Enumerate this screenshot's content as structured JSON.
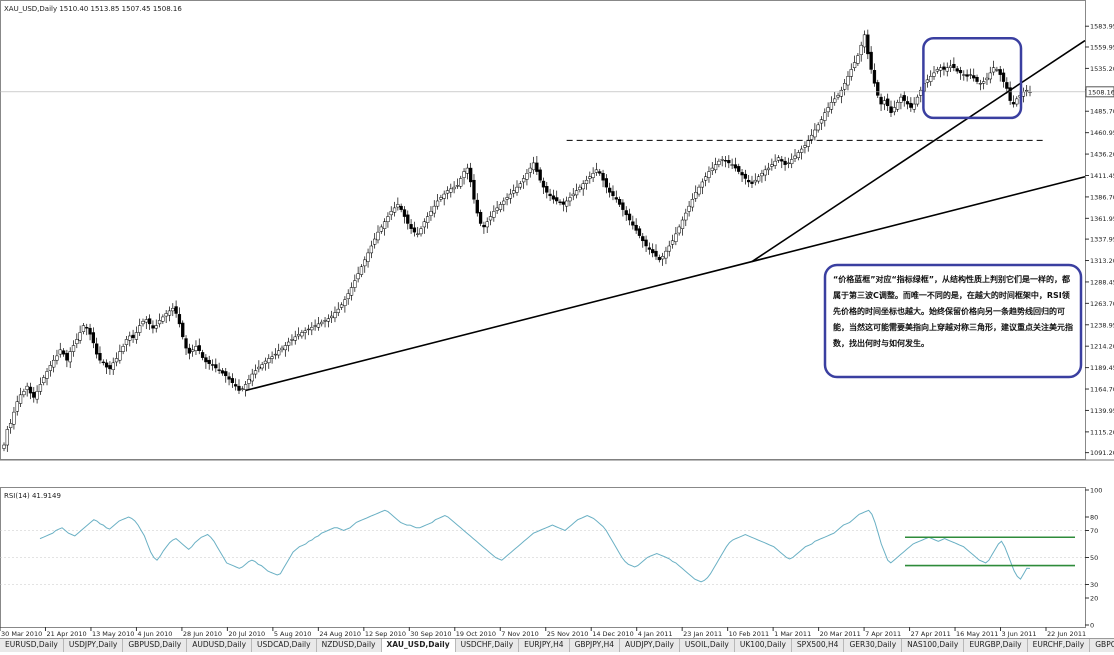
{
  "price_header": "XAU_USD,Daily  1510.40 1513.85 1507.45 1508.16",
  "rsi_header": "RSI(14) 41.9149",
  "current_price_label": "1508.16",
  "annotation_text": "“价格蓝框”对应“指标绿框”，从结构性质上判别它们是一样的，都属于第三波C调整。而唯一不同的是，在越大的时间框架中，RSI领先价格的时间坐标也越大。始终保留价格向另一条趋势线回归的可能，当然这可能需要美指向上穿越对称三角形，建议重点关注美元指数，找出何时与如何发生。",
  "colors": {
    "up_candle": "#ffffff",
    "down_candle": "#000000",
    "rsi_line": "#6ab0c4",
    "blue_box": "#3a3fa0",
    "green_box": "#2e8b3a",
    "grid": "#c8c8c8"
  },
  "chart_data": [
    {
      "type": "candlestick",
      "symbol": "XAU_USD",
      "timeframe": "Daily",
      "ohlc_last": {
        "open": 1510.4,
        "high": 1513.85,
        "low": 1507.45,
        "close": 1508.16
      },
      "y_ticks": [
        "1583.95",
        "1559.95",
        "1535.20",
        "1510.45",
        "1485.70",
        "1460.95",
        "1436.20",
        "1411.45",
        "1386.70",
        "1361.95",
        "1337.95",
        "1313.20",
        "1288.45",
        "1263.70",
        "1238.95",
        "1214.20",
        "1189.45",
        "1164.70",
        "1139.95",
        "1115.20",
        "1091.20"
      ],
      "x_ticks": [
        "30 Mar 2010",
        "21 Apr 2010",
        "13 May 2010",
        "4 Jun 2010",
        "28 Jun 2010",
        "20 Jul 2010",
        "5 Aug 2010",
        "24 Aug 2010",
        "12 Sep 2010",
        "30 Sep 2010",
        "19 Oct 2010",
        "7 Nov 2010",
        "25 Nov 2010",
        "14 Dec 2010",
        "4 Jan 2011",
        "23 Jan 2011",
        "10 Feb 2011",
        "1 Mar 2011",
        "20 Mar 2011",
        "7 Apr 2011",
        "27 Apr 2011",
        "16 May 2011",
        "3 Jun 2011",
        "22 Jun 2011"
      ],
      "ylim": [
        1085,
        1605
      ],
      "closes": [
        1100,
        1118,
        1125,
        1138,
        1150,
        1158,
        1162,
        1168,
        1160,
        1155,
        1162,
        1170,
        1178,
        1185,
        1192,
        1198,
        1203,
        1210,
        1205,
        1198,
        1208,
        1215,
        1222,
        1230,
        1238,
        1235,
        1228,
        1218,
        1205,
        1198,
        1195,
        1190,
        1188,
        1195,
        1200,
        1208,
        1214,
        1222,
        1226,
        1224,
        1230,
        1238,
        1243,
        1245,
        1240,
        1235,
        1238,
        1244,
        1248,
        1252,
        1255,
        1258,
        1252,
        1240,
        1225,
        1212,
        1206,
        1210,
        1214,
        1209,
        1201,
        1196,
        1194,
        1192,
        1189,
        1186,
        1183,
        1180,
        1176,
        1172,
        1168,
        1163,
        1165,
        1170,
        1176,
        1182,
        1186,
        1190,
        1193,
        1197,
        1200,
        1202,
        1205,
        1209,
        1212,
        1215,
        1219,
        1222,
        1225,
        1228,
        1230,
        1232,
        1234,
        1236,
        1238,
        1240,
        1242,
        1244,
        1246,
        1249,
        1253,
        1257,
        1262,
        1268,
        1275,
        1282,
        1290,
        1298,
        1306,
        1314,
        1322,
        1330,
        1338,
        1346,
        1352,
        1358,
        1364,
        1370,
        1374,
        1378,
        1372,
        1364,
        1356,
        1350,
        1346,
        1344,
        1350,
        1358,
        1364,
        1370,
        1376,
        1382,
        1386,
        1390,
        1394,
        1396,
        1398,
        1400,
        1408,
        1416,
        1420,
        1404,
        1384,
        1368,
        1356,
        1352,
        1358,
        1364,
        1370,
        1374,
        1378,
        1382,
        1386,
        1390,
        1394,
        1398,
        1402,
        1408,
        1414,
        1420,
        1426,
        1416,
        1406,
        1398,
        1392,
        1388,
        1384,
        1382,
        1380,
        1378,
        1382,
        1386,
        1390,
        1394,
        1398,
        1402,
        1406,
        1410,
        1414,
        1418,
        1414,
        1406,
        1398,
        1392,
        1388,
        1384,
        1378,
        1372,
        1366,
        1360,
        1354,
        1348,
        1342,
        1336,
        1330,
        1326,
        1322,
        1318,
        1314,
        1318,
        1324,
        1330,
        1336,
        1344,
        1352,
        1360,
        1368,
        1376,
        1384,
        1392,
        1398,
        1404,
        1410,
        1416,
        1420,
        1424,
        1428,
        1430,
        1428,
        1426,
        1424,
        1420,
        1416,
        1412,
        1408,
        1404,
        1402,
        1406,
        1410,
        1414,
        1418,
        1420,
        1424,
        1428,
        1432,
        1428,
        1424,
        1426,
        1430,
        1434,
        1438,
        1442,
        1446,
        1452,
        1458,
        1464,
        1470,
        1476,
        1484,
        1490,
        1496,
        1500,
        1504,
        1510,
        1518,
        1526,
        1534,
        1542,
        1550,
        1562,
        1574,
        1552,
        1534,
        1518,
        1504,
        1494,
        1498,
        1492,
        1484,
        1490,
        1496,
        1502,
        1498,
        1494,
        1490,
        1494,
        1502,
        1510,
        1518,
        1522,
        1526,
        1530,
        1534,
        1536,
        1534,
        1536,
        1538,
        1536,
        1532,
        1530,
        1528,
        1526,
        1528,
        1524,
        1520,
        1518,
        1520,
        1524,
        1530,
        1536,
        1534,
        1528,
        1520,
        1512,
        1498,
        1494,
        1500,
        1504,
        1508,
        1510,
        1508.16
      ]
    },
    {
      "type": "line",
      "name": "RSI(14)",
      "value_last": 41.9149,
      "y_ticks": [
        100,
        80,
        70,
        50,
        30,
        20,
        0
      ],
      "ylim": [
        0,
        100
      ],
      "values": [
        64,
        65,
        66,
        67,
        68,
        70,
        71,
        72,
        70,
        68,
        67,
        66,
        68,
        70,
        72,
        74,
        76,
        78,
        77,
        75,
        74,
        72,
        71,
        73,
        75,
        77,
        78,
        79,
        80,
        79,
        77,
        74,
        70,
        66,
        60,
        54,
        50,
        48,
        51,
        55,
        58,
        61,
        63,
        64,
        62,
        60,
        58,
        56,
        58,
        61,
        63,
        65,
        66,
        67,
        65,
        62,
        58,
        54,
        50,
        46,
        45,
        44,
        43,
        42,
        43,
        45,
        47,
        48,
        47,
        45,
        44,
        42,
        40,
        39,
        38,
        37,
        38,
        42,
        46,
        50,
        54,
        56,
        58,
        59,
        60,
        62,
        63,
        65,
        66,
        68,
        69,
        70,
        71,
        72,
        72,
        71,
        70,
        71,
        72,
        74,
        76,
        77,
        78,
        79,
        80,
        81,
        82,
        83,
        84,
        85,
        84,
        82,
        80,
        78,
        76,
        75,
        74,
        74,
        73,
        72,
        72,
        73,
        74,
        75,
        76,
        78,
        79,
        80,
        81,
        80,
        78,
        76,
        74,
        72,
        70,
        68,
        66,
        64,
        62,
        60,
        58,
        56,
        54,
        52,
        50,
        49,
        48,
        50,
        52,
        54,
        56,
        58,
        60,
        62,
        64,
        66,
        68,
        69,
        70,
        71,
        72,
        73,
        74,
        73,
        72,
        71,
        70,
        72,
        74,
        76,
        78,
        79,
        80,
        81,
        80,
        79,
        77,
        75,
        73,
        70,
        66,
        62,
        58,
        54,
        50,
        47,
        45,
        44,
        43,
        44,
        46,
        48,
        50,
        51,
        52,
        53,
        52,
        51,
        50,
        49,
        47,
        46,
        44,
        42,
        40,
        38,
        36,
        34,
        33,
        32,
        33,
        35,
        38,
        42,
        46,
        50,
        54,
        58,
        61,
        63,
        64,
        65,
        66,
        67,
        66,
        65,
        64,
        63,
        62,
        61,
        60,
        59,
        58,
        56,
        54,
        52,
        50,
        49,
        50,
        52,
        54,
        56,
        58,
        59,
        60,
        62,
        63,
        64,
        65,
        66,
        67,
        68,
        70,
        72,
        74,
        75,
        76,
        78,
        80,
        82,
        83,
        84,
        85,
        82,
        76,
        68,
        60,
        54,
        48,
        46,
        48,
        50,
        52,
        54,
        56,
        58,
        60,
        61,
        62,
        63,
        64,
        65,
        64,
        63,
        62,
        63,
        64,
        63,
        62,
        61,
        60,
        59,
        58,
        56,
        54,
        52,
        50,
        48,
        47,
        46,
        48,
        52,
        56,
        60,
        62,
        58,
        52,
        46,
        40,
        36,
        34,
        38,
        42,
        41.9149
      ]
    }
  ],
  "tabs": [
    {
      "label": "EURUSD,Daily",
      "active": false
    },
    {
      "label": "USDJPY,Daily",
      "active": false
    },
    {
      "label": "GBPUSD,Daily",
      "active": false
    },
    {
      "label": "AUDUSD,Daily",
      "active": false
    },
    {
      "label": "USDCAD,Daily",
      "active": false
    },
    {
      "label": "NZDUSD,Daily",
      "active": false
    },
    {
      "label": "XAU_USD,Daily",
      "active": true
    },
    {
      "label": "USDCHF,Daily",
      "active": false
    },
    {
      "label": "EURJPY,H4",
      "active": false
    },
    {
      "label": "GBPJPY,H4",
      "active": false
    },
    {
      "label": "AUDJPY,Daily",
      "active": false
    },
    {
      "label": "USOIL,Daily",
      "active": false
    },
    {
      "label": "UK100,Daily",
      "active": false
    },
    {
      "label": "SPX500,H4",
      "active": false
    },
    {
      "label": "GER30,Daily",
      "active": false
    },
    {
      "label": "NAS100,Daily",
      "active": false
    },
    {
      "label": "EURGBP,Daily",
      "active": false
    },
    {
      "label": "EURCHF,Daily",
      "active": false
    },
    {
      "label": "GBPCHF",
      "active": false
    }
  ]
}
